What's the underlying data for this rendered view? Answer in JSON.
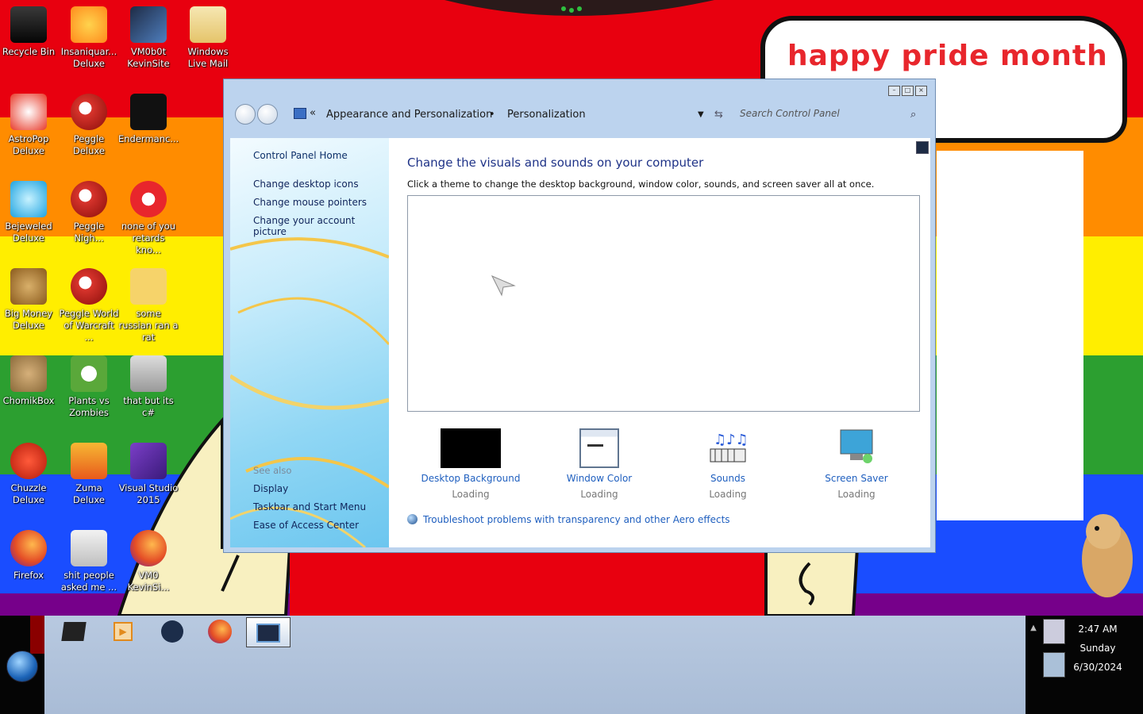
{
  "desktop": {
    "pride_message": "happy pride month",
    "stripe_colors": [
      "#e8000f",
      "#ff8c00",
      "#ffee00",
      "#2c9f30",
      "#1a4dff",
      "#76008a"
    ],
    "icons": [
      {
        "label": "Recycle Bin",
        "icon": "recycle-bin-icon"
      },
      {
        "label": "Insaniquar... Deluxe",
        "icon": "insaniquarium-icon"
      },
      {
        "label": "VM0b0t KevinSite",
        "icon": "vm-icon"
      },
      {
        "label": "Windows Live Mail",
        "icon": "mail-icon"
      },
      {
        "label": "AstroPop Deluxe",
        "icon": "astropop-icon"
      },
      {
        "label": "Peggle Deluxe",
        "icon": "peggle-icon"
      },
      {
        "label": "Endermanc...",
        "icon": "console-icon"
      },
      {
        "label": "Bejeweled Deluxe",
        "icon": "gem-icon"
      },
      {
        "label": "Peggle Nigh...",
        "icon": "peggle-icon"
      },
      {
        "label": "none of you retards kno...",
        "icon": "shortcut-icon"
      },
      {
        "label": "Big Money Deluxe",
        "icon": "money-bag-icon"
      },
      {
        "label": "Peggle World of Warcraft ...",
        "icon": "peggle-icon"
      },
      {
        "label": "some russian ran a rat",
        "icon": "de-icon"
      },
      {
        "label": "ChomikBox",
        "icon": "hamster-icon"
      },
      {
        "label": "Plants vs Zombies",
        "icon": "plant-icon"
      },
      {
        "label": "that but its c#",
        "icon": "windows-copy-icon"
      },
      {
        "label": "Chuzzle Deluxe",
        "icon": "chuzzle-icon"
      },
      {
        "label": "Zuma Deluxe",
        "icon": "zuma-icon"
      },
      {
        "label": "Visual Studio 2015",
        "icon": "visual-studio-icon"
      },
      {
        "label": "Firefox",
        "icon": "firefox-icon"
      },
      {
        "label": "shit people asked me ...",
        "icon": "file-icon"
      },
      {
        "label": "VM0 KevinSi...",
        "icon": "firefox-icon"
      }
    ]
  },
  "window": {
    "breadcrumb": [
      "Appearance and Personalization",
      "Personalization"
    ],
    "search_placeholder": "Search Control Panel",
    "sidebar": {
      "home": "Control Panel Home",
      "links": [
        "Change desktop icons",
        "Change mouse pointers",
        "Change your account picture"
      ],
      "see_also_label": "See also",
      "see_also": [
        "Display",
        "Taskbar and Start Menu",
        "Ease of Access Center"
      ]
    },
    "main": {
      "title": "Change the visuals and sounds on your computer",
      "subtitle": "Click a theme to change the desktop background, window color, sounds, and screen saver all at once.",
      "options": [
        {
          "label": "Desktop Background",
          "status": "Loading"
        },
        {
          "label": "Window Color",
          "status": "Loading"
        },
        {
          "label": "Sounds",
          "status": "Loading"
        },
        {
          "label": "Screen Saver",
          "status": "Loading"
        }
      ],
      "troubleshoot": "Troubleshoot problems with transparency and other Aero effects"
    }
  },
  "taskbar": {
    "clock": {
      "time": "2:47 AM",
      "day": "Sunday",
      "date": "6/30/2024"
    }
  }
}
